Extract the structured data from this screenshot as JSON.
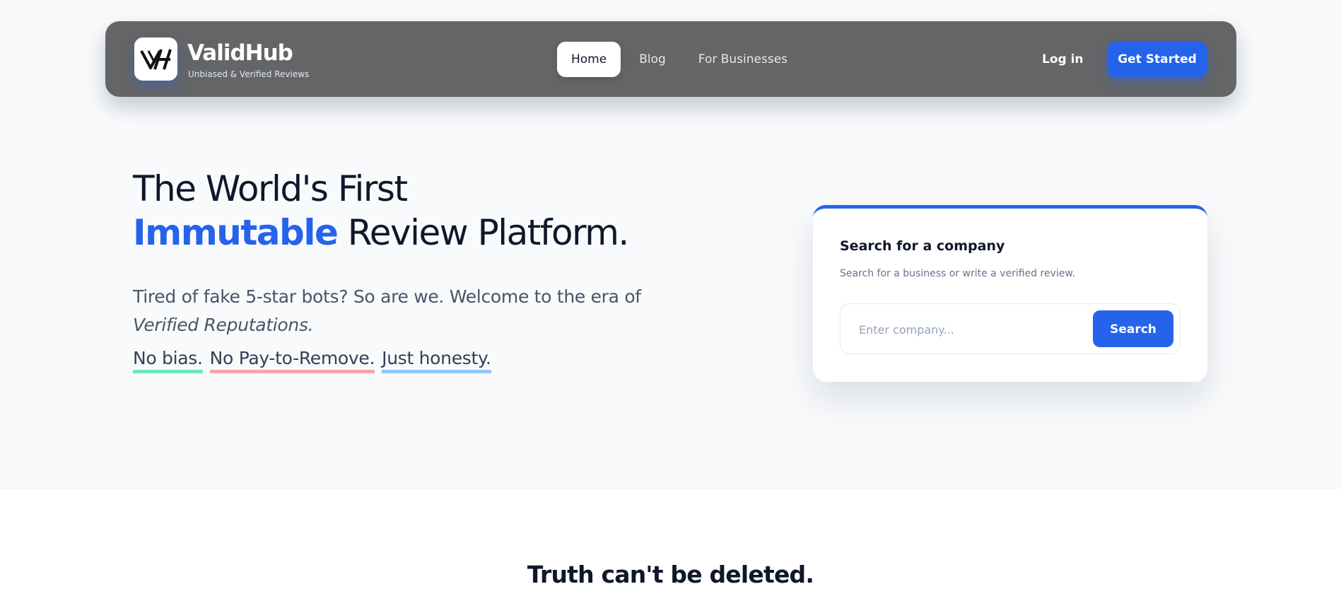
{
  "colors": {
    "accent": "#2563eb",
    "navbar": "#646566",
    "background": "#f8fafc",
    "pill_green": "#6ee7b7",
    "pill_red": "#fca5a5",
    "pill_blue": "#93c5fd"
  },
  "navbar": {
    "logo_icon": "validhub-logo-icon",
    "brand": "ValidHub",
    "tagline": "Unbiased & Verified Reviews",
    "links": [
      {
        "label": "Home",
        "active": true
      },
      {
        "label": "Blog",
        "active": false
      },
      {
        "label": "For Businesses",
        "active": false
      }
    ],
    "login": "Log in",
    "get_started": "Get Started"
  },
  "hero": {
    "title_line1": "The World's First",
    "title_accent": "Immutable",
    "title_line2_rest": " Review Platform.",
    "subtitle_plain": "Tired of fake 5-star bots? So are we. Welcome to the era of ",
    "subtitle_italic": "Verified Reputations.",
    "pills": [
      "No bias.",
      "No Pay-to-Remove.",
      "Just honesty."
    ]
  },
  "search_card": {
    "title": "Search for a company",
    "subtitle": "Search for a business or write a verified review.",
    "placeholder": "Enter company...",
    "button": "Search"
  },
  "lower": {
    "title": "Truth can't be deleted."
  }
}
